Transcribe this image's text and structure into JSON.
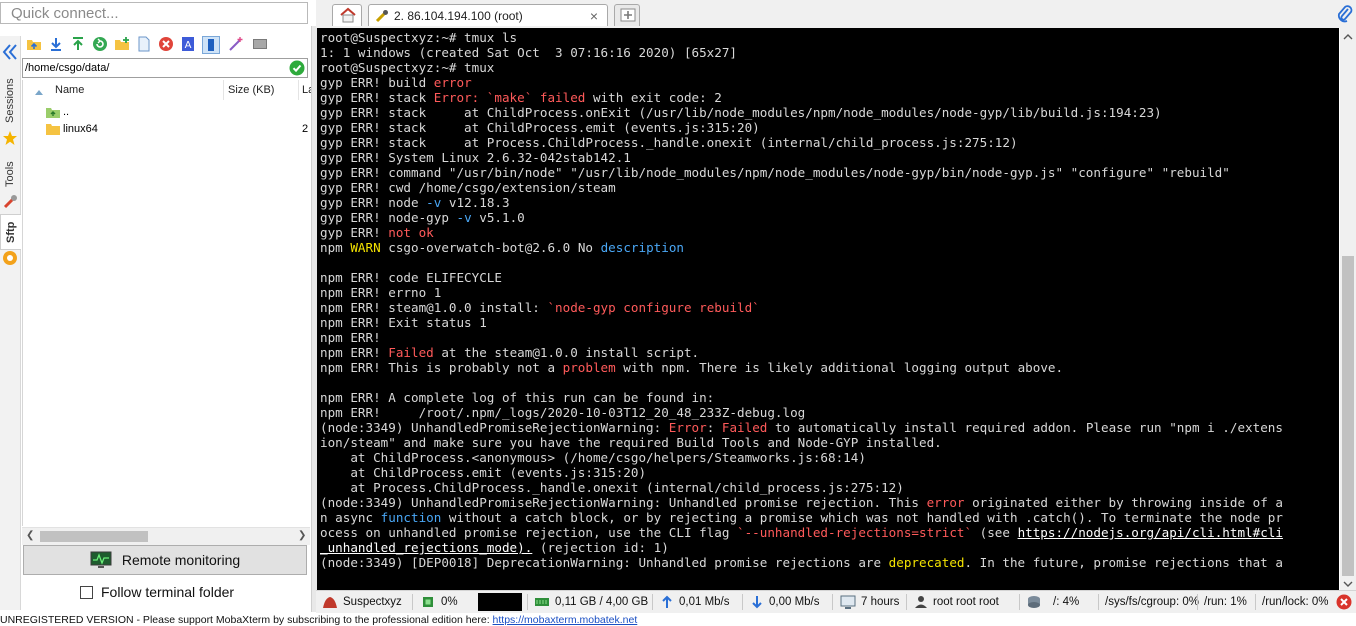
{
  "quick_connect": {
    "placeholder": "Quick connect..."
  },
  "side_tabs": {
    "sessions": "Sessions",
    "tools": "Tools",
    "sftp": "Sftp"
  },
  "sftp": {
    "path": "/home/csgo/data/",
    "columns": {
      "name": "Name",
      "size": "Size (KB)",
      "last": "La"
    },
    "rows": [
      {
        "name": "..",
        "size": "",
        "last": ""
      },
      {
        "name": "linux64",
        "size": "",
        "last": "2"
      }
    ],
    "remote_monitoring_label": "Remote monitoring",
    "follow_terminal_label": "Follow terminal folder"
  },
  "tabs": {
    "session_title": "2. 86.104.194.100 (root)",
    "close_glyph": "×"
  },
  "terminal": {
    "lines": [
      [
        {
          "t": "root@Suspectxyz:~# tmux ls"
        }
      ],
      [
        {
          "t": "1: 1 windows (created Sat Oct  3 07:16:16 2020) [65x27]"
        }
      ],
      [
        {
          "t": "root@Suspectxyz:~# tmux"
        }
      ],
      [
        {
          "t": "gyp ERR! build "
        },
        {
          "t": "error",
          "c": "red"
        }
      ],
      [
        {
          "t": "gyp ERR! stack "
        },
        {
          "t": "Error: `make` failed",
          "c": "red"
        },
        {
          "t": " with exit code: 2"
        }
      ],
      [
        {
          "t": "gyp ERR! stack     at ChildProcess.onExit (/usr/lib/node_modules/npm/node_modules/node-gyp/lib/build.js:194:23)"
        }
      ],
      [
        {
          "t": "gyp ERR! stack     at ChildProcess.emit (events.js:315:20)"
        }
      ],
      [
        {
          "t": "gyp ERR! stack     at Process.ChildProcess._handle.onexit (internal/child_process.js:275:12)"
        }
      ],
      [
        {
          "t": "gyp ERR! System Linux 2.6.32-042stab142.1"
        }
      ],
      [
        {
          "t": "gyp ERR! command \"/usr/bin/node\" \"/usr/lib/node_modules/npm/node_modules/node-gyp/bin/node-gyp.js\" \"configure\" \"rebuild\""
        }
      ],
      [
        {
          "t": "gyp ERR! cwd /home/csgo/extension/steam"
        }
      ],
      [
        {
          "t": "gyp ERR! node "
        },
        {
          "t": "-v",
          "c": "blue"
        },
        {
          "t": " v12.18.3"
        }
      ],
      [
        {
          "t": "gyp ERR! node-gyp "
        },
        {
          "t": "-v",
          "c": "blue"
        },
        {
          "t": " v5.1.0"
        }
      ],
      [
        {
          "t": "gyp ERR! "
        },
        {
          "t": "not ok",
          "c": "red"
        }
      ],
      [
        {
          "t": "npm "
        },
        {
          "t": "WARN",
          "c": "yellow"
        },
        {
          "t": " csgo-overwatch-bot@2.6.0 No "
        },
        {
          "t": "description",
          "c": "blue"
        }
      ],
      [
        {
          "t": ""
        }
      ],
      [
        {
          "t": "npm ERR! code ELIFECYCLE"
        }
      ],
      [
        {
          "t": "npm ERR! errno 1"
        }
      ],
      [
        {
          "t": "npm ERR! steam@1.0.0 install: "
        },
        {
          "t": "`node-gyp configure rebuild`",
          "c": "red"
        }
      ],
      [
        {
          "t": "npm ERR! Exit status 1"
        }
      ],
      [
        {
          "t": "npm ERR!"
        }
      ],
      [
        {
          "t": "npm ERR! "
        },
        {
          "t": "Failed",
          "c": "red"
        },
        {
          "t": " at the steam@1.0.0 install script."
        }
      ],
      [
        {
          "t": "npm ERR! This is probably not a "
        },
        {
          "t": "problem",
          "c": "red"
        },
        {
          "t": " with npm. There is likely additional logging output above."
        }
      ],
      [
        {
          "t": ""
        }
      ],
      [
        {
          "t": "npm ERR! A complete log of this run can be found in:"
        }
      ],
      [
        {
          "t": "npm ERR!     /root/.npm/_logs/2020-10-03T12_20_48_233Z-debug.log"
        }
      ],
      [
        {
          "t": "(node:3349) UnhandledPromiseRejectionWarning: "
        },
        {
          "t": "Error",
          "c": "red"
        },
        {
          "t": ": "
        },
        {
          "t": "Failed",
          "c": "red"
        },
        {
          "t": " to automatically install required addon. Please run \"npm i ./extens"
        }
      ],
      [
        {
          "t": "ion/steam\" and make sure you have the required Build Tools and Node-GYP installed."
        }
      ],
      [
        {
          "t": "    at ChildProcess.<anonymous> (/home/csgo/helpers/Steamworks.js:68:14)"
        }
      ],
      [
        {
          "t": "    at ChildProcess.emit (events.js:315:20)"
        }
      ],
      [
        {
          "t": "    at Process.ChildProcess._handle.onexit (internal/child_process.js:275:12)"
        }
      ],
      [
        {
          "t": "(node:3349) UnhandledPromiseRejectionWarning: Unhandled promise rejection. This "
        },
        {
          "t": "error",
          "c": "red"
        },
        {
          "t": " originated either by throwing inside of a"
        }
      ],
      [
        {
          "t": "n async "
        },
        {
          "t": "function",
          "c": "blue"
        },
        {
          "t": " without a catch block, or by rejecting a promise which was not handled with .catch(). To terminate the node pr"
        }
      ],
      [
        {
          "t": "ocess on unhandled promise rejection, use the CLI flag "
        },
        {
          "t": "`--unhandled-rejections=strict`",
          "c": "red"
        },
        {
          "t": " (see "
        },
        {
          "t": "https://nodejs.org/api/cli.html#cli",
          "c": "link"
        }
      ],
      [
        {
          "t": "_unhandled_rejections_mode).",
          "c": "link"
        },
        {
          "t": " (rejection id: 1)"
        }
      ],
      [
        {
          "t": "(node:3349) [DEP0018] DeprecationWarning: Unhandled promise rejections are "
        },
        {
          "t": "deprecated",
          "c": "yellow"
        },
        {
          "t": ". In the future, promise rejections that a"
        }
      ]
    ]
  },
  "statusbar": {
    "host": "Suspectxyz",
    "cpu": "0%",
    "memory": "0,11 GB / 4,00 GB",
    "upload": "0,01 Mb/s",
    "download": "0,00 Mb/s",
    "uptime": "7 hours",
    "users": "root  root  root",
    "disk_root": "/: 4%",
    "disk_cgroup": "/sys/fs/cgroup: 0%",
    "disk_run": "/run: 1%",
    "disk_runlock": "/run/lock: 0%"
  },
  "notice": {
    "text": "UNREGISTERED VERSION  -  Please support MobaXterm by subscribing to the professional edition here:  ",
    "link": "https://mobaxterm.mobatek.net"
  },
  "colors": {
    "terminal_bg": "#000000",
    "error_red": "#ff5a5a",
    "warn_yellow": "#f4e300",
    "info_blue": "#4aa7f5",
    "accent_green": "#2eaa3c"
  }
}
